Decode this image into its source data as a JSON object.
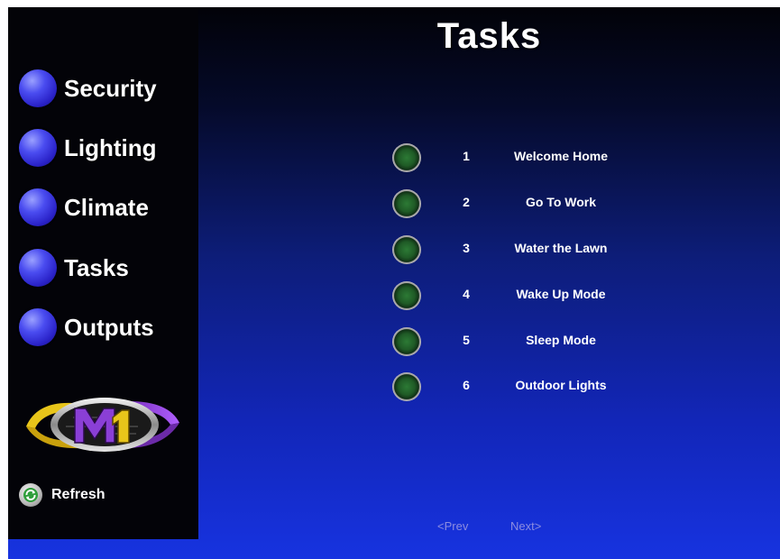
{
  "page": {
    "title": "Tasks"
  },
  "sidebar": {
    "items": [
      {
        "label": "Security"
      },
      {
        "label": "Lighting"
      },
      {
        "label": "Climate"
      },
      {
        "label": "Tasks"
      },
      {
        "label": "Outputs"
      }
    ],
    "logo": {
      "icon": "m1-logo",
      "text": "M1"
    },
    "refresh": {
      "label": "Refresh",
      "icon": "refresh-icon"
    }
  },
  "tasks": [
    {
      "number": "1",
      "name": "Welcome Home"
    },
    {
      "number": "2",
      "name": "Go To Work"
    },
    {
      "number": "3",
      "name": "Water the Lawn"
    },
    {
      "number": "4",
      "name": "Wake Up Mode"
    },
    {
      "number": "5",
      "name": "Sleep Mode"
    },
    {
      "number": "6",
      "name": "Outdoor Lights"
    }
  ],
  "pager": {
    "prev_label": "<Prev",
    "next_label": "Next>"
  },
  "colors": {
    "orb": "#3a33e0",
    "led": "#2c7a35",
    "pager_text": "#8c8ce0"
  }
}
